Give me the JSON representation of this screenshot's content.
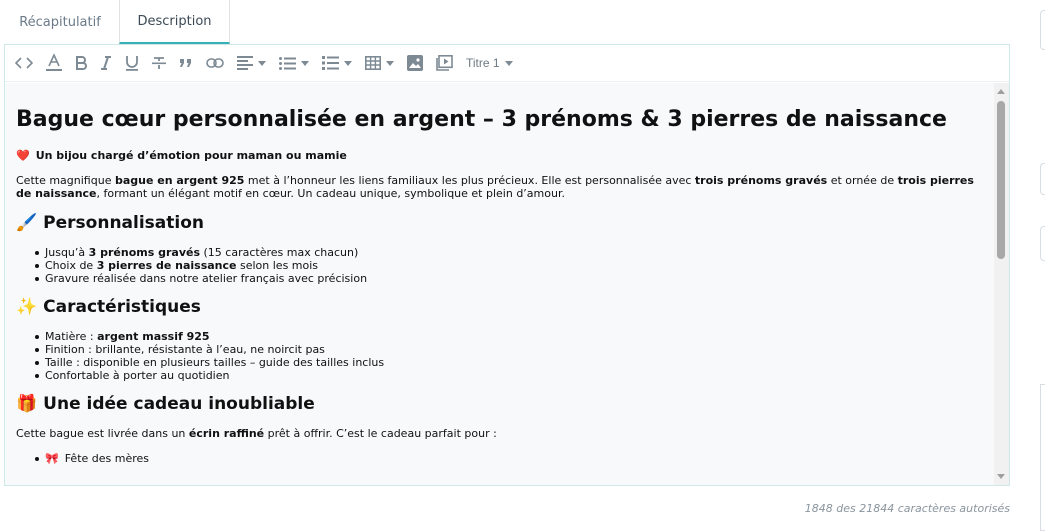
{
  "tabs": [
    {
      "label": "Récapitulatif",
      "active": false
    },
    {
      "label": "Description",
      "active": true
    }
  ],
  "toolbar": {
    "icons": [
      "code-icon",
      "text-color-icon",
      "bold-icon",
      "italic-icon",
      "underline-icon",
      "strikethrough-icon",
      "quote-icon",
      "link-icon",
      "align-icon",
      "bullet-list-icon",
      "numbered-list-icon",
      "table-icon",
      "image-icon",
      "video-icon"
    ],
    "heading_label": "Titre 1"
  },
  "content": {
    "title": "Bague cœur personnalisée en argent – 3 prénoms & 3 pierres de naissance",
    "lead_emoji": "❤️",
    "lead": "Un bijou chargé d’émotion pour maman ou mamie",
    "intro": {
      "t1": "Cette magnifique ",
      "b1": "bague en argent 925",
      "t2": " met à l’honneur les liens familiaux les plus précieux. Elle est personnalisée avec ",
      "b2": "trois prénoms gravés",
      "t3": " et ornée de ",
      "b3": "trois pierres de naissance",
      "t4": ", formant un élégant motif en cœur. Un cadeau unique, symbolique et plein d’amour."
    },
    "section1": {
      "emoji": "🖌️",
      "title": "Personnalisation",
      "items": [
        {
          "t1": "Jusqu’à ",
          "b": "3 prénoms gravés",
          "t2": " (15 caractères max chacun)"
        },
        {
          "t1": "Choix de ",
          "b": "3 pierres de naissance",
          "t2": " selon les mois"
        },
        {
          "t1": "Gravure réalisée dans notre atelier français avec précision",
          "b": "",
          "t2": ""
        }
      ]
    },
    "section2": {
      "emoji": "✨",
      "title": "Caractéristiques",
      "items": [
        {
          "t1": "Matière : ",
          "b": "argent massif 925",
          "t2": ""
        },
        {
          "t1": "Finition : brillante, résistante à l’eau, ne noircit pas",
          "b": "",
          "t2": ""
        },
        {
          "t1": "Taille : disponible en plusieurs tailles – guide des tailles inclus",
          "b": "",
          "t2": ""
        },
        {
          "t1": "Confortable à porter au quotidien",
          "b": "",
          "t2": ""
        }
      ]
    },
    "section3": {
      "emoji": "🎁",
      "title": "Une idée cadeau inoubliable",
      "para": {
        "t1": "Cette bague est livrée dans un ",
        "b": "écrin raffiné",
        "t2": " prêt à offrir. C’est le cadeau parfait pour :"
      },
      "items": [
        {
          "emoji": "🎀",
          "text": "Fête des mères"
        }
      ]
    }
  },
  "counter": "1848 des 21844 caractères autorisés",
  "colors": {
    "accent": "#35b0b4",
    "toolbar_icon": "#7d8a94",
    "content_bg": "#f7f9fb"
  }
}
